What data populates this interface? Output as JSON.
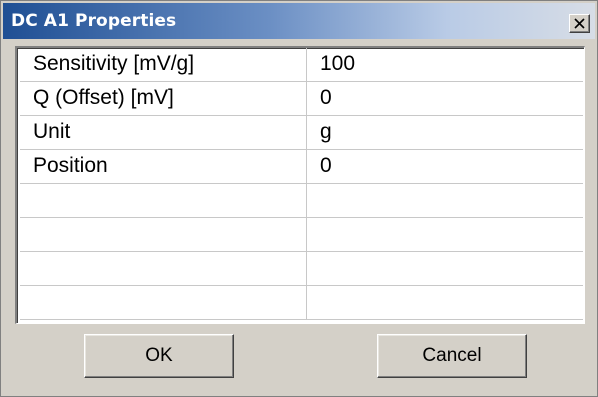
{
  "window": {
    "title": "DC A1 Properties",
    "close_icon": "close-icon",
    "titlebar_color": "#1f4f94"
  },
  "properties": [
    {
      "name": "Sensitivity [mV/g]",
      "value": "100"
    },
    {
      "name": "Q (Offset) [mV]",
      "value": "0"
    },
    {
      "name": "Unit",
      "value": "g"
    },
    {
      "name": "Position",
      "value": "0"
    },
    {
      "name": "",
      "value": ""
    },
    {
      "name": "",
      "value": ""
    },
    {
      "name": "",
      "value": ""
    },
    {
      "name": "",
      "value": ""
    }
  ],
  "buttons": {
    "ok_label": "OK",
    "cancel_label": "Cancel"
  }
}
